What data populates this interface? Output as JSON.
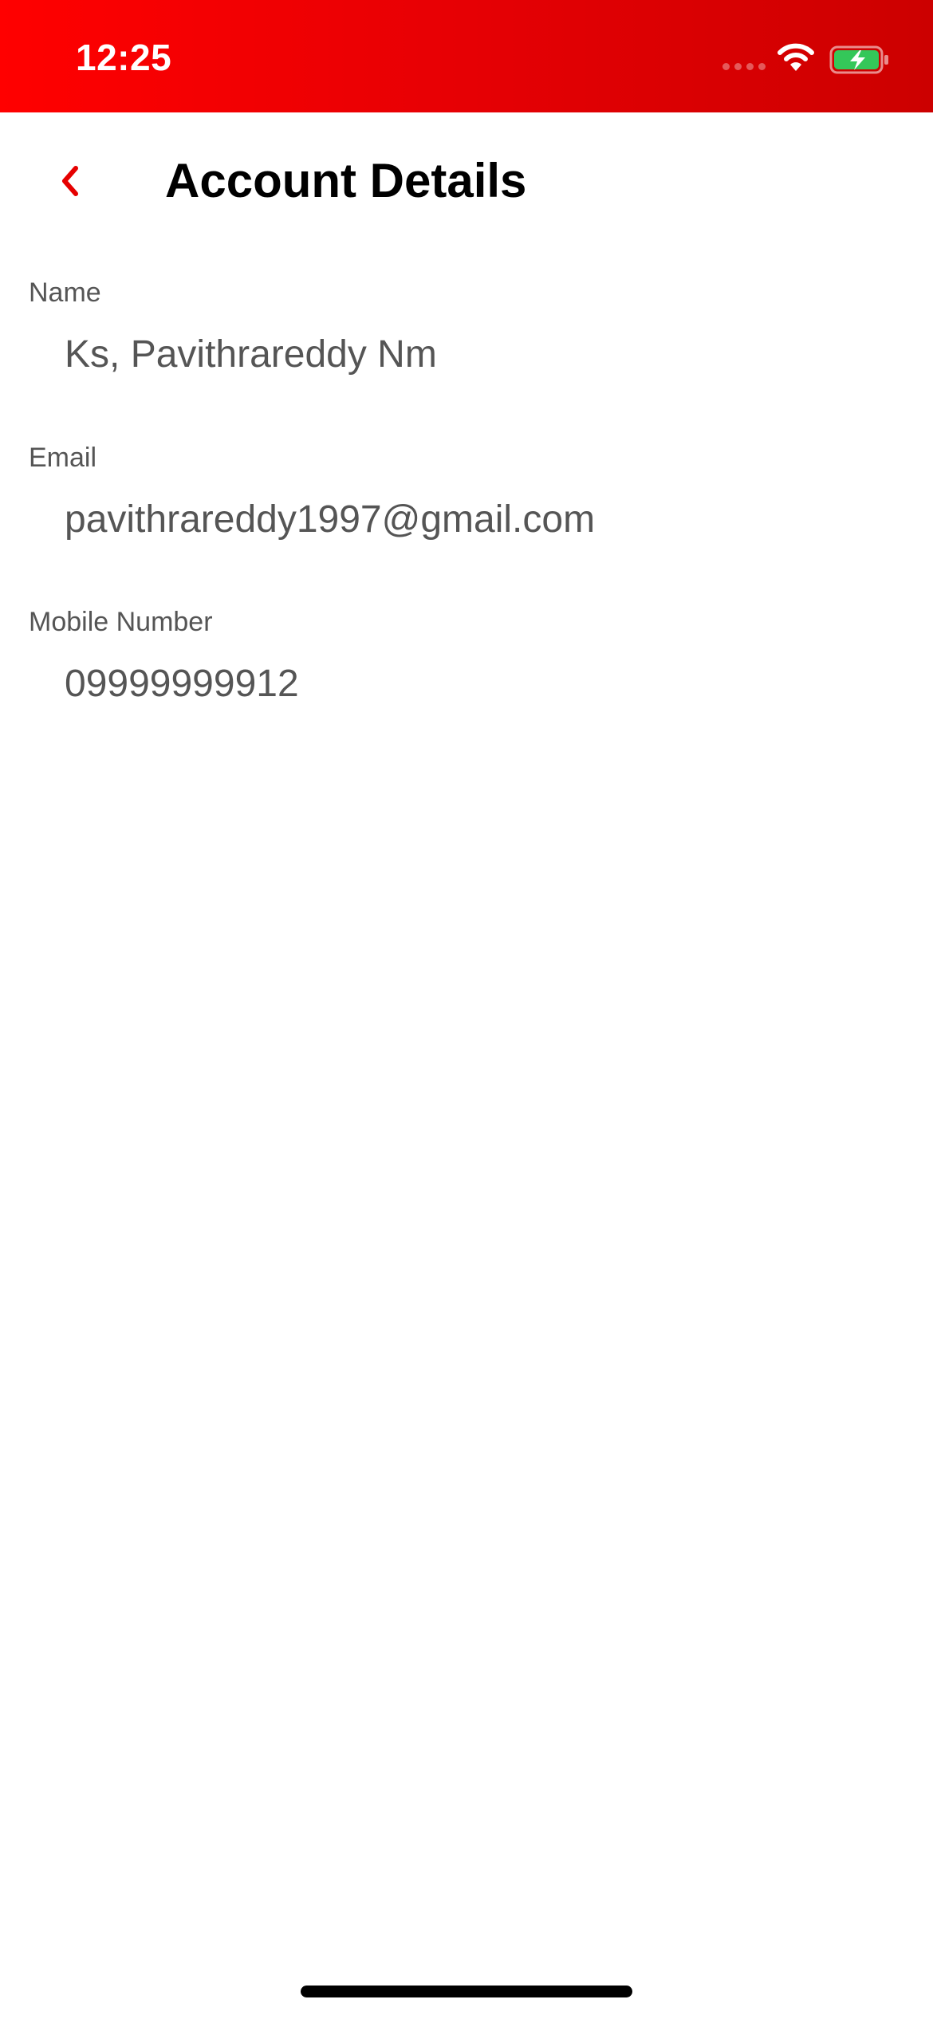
{
  "status_bar": {
    "time": "12:25",
    "background_start": "#ff0000",
    "background_end": "#cc0000",
    "battery_color": "#34c759"
  },
  "header": {
    "back_icon": "chevron-left-icon",
    "title": "Account Details",
    "accent_color": "#e60000"
  },
  "fields": [
    {
      "label": "Name",
      "value": "Ks, Pavithrareddy Nm"
    },
    {
      "label": "Email",
      "value": "pavithrareddy1997@gmail.com"
    },
    {
      "label": "Mobile Number",
      "value": "09999999912"
    }
  ]
}
